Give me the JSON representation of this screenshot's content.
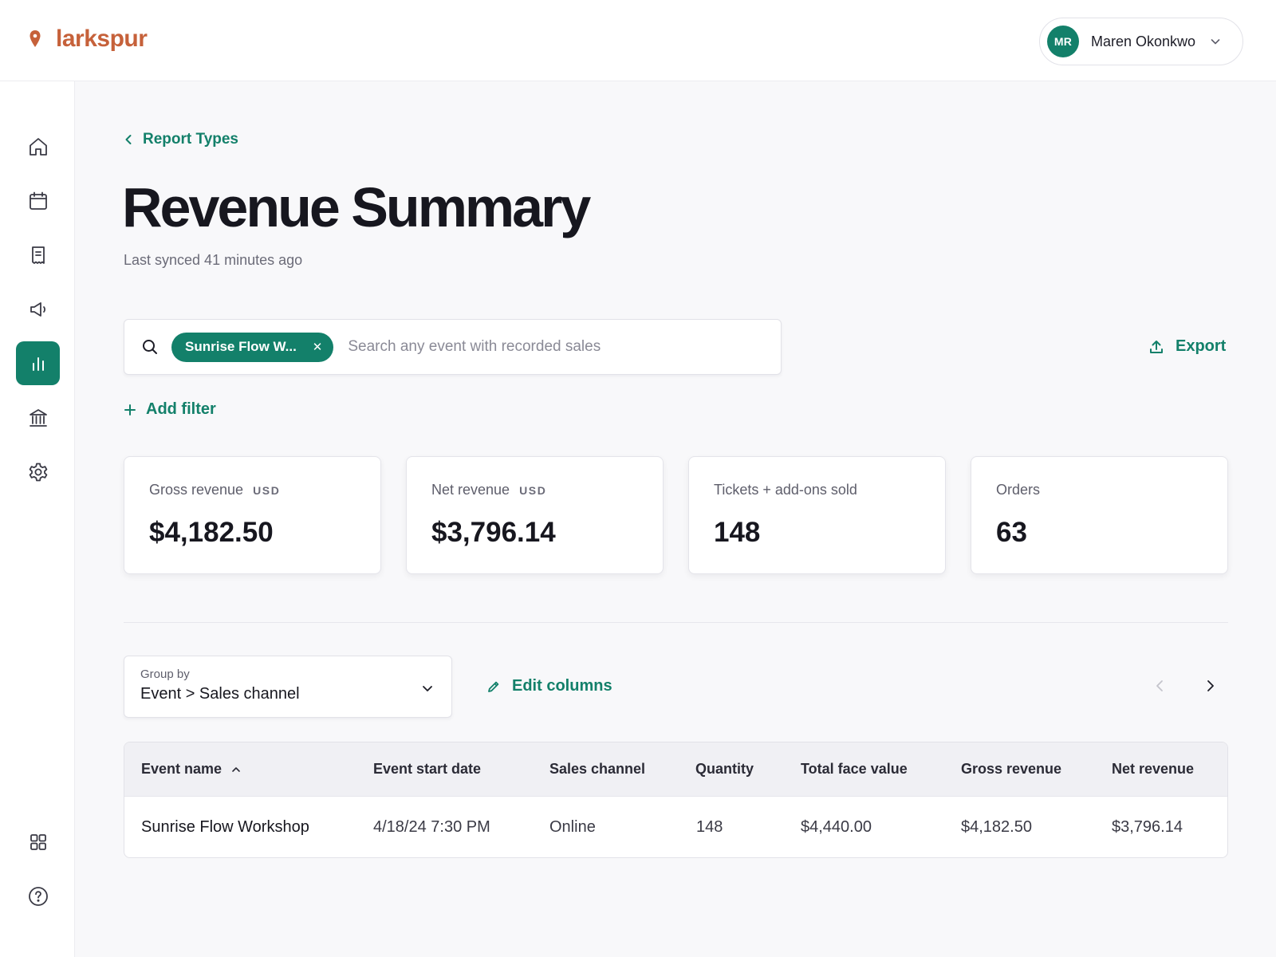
{
  "app": {
    "brand": "larkspur",
    "brand_color": "#c6613a",
    "accent_color": "#13806a"
  },
  "user": {
    "initials": "MR",
    "name": "Maren Okonkwo"
  },
  "sidebar": {
    "items": [
      {
        "icon": "home-icon",
        "active": false
      },
      {
        "icon": "calendar-icon",
        "active": false
      },
      {
        "icon": "receipt-icon",
        "active": false
      },
      {
        "icon": "megaphone-icon",
        "active": false
      },
      {
        "icon": "bar-chart-icon",
        "active": true
      },
      {
        "icon": "bank-icon",
        "active": false
      },
      {
        "icon": "gear-icon",
        "active": false
      }
    ],
    "bottom_items": [
      {
        "icon": "apps-grid-icon"
      },
      {
        "icon": "help-icon"
      }
    ]
  },
  "breadcrumb": {
    "label": "Report Types"
  },
  "page": {
    "title": "Revenue Summary",
    "sync_status": "Last synced 41 minutes ago"
  },
  "search": {
    "chip_label": "Sunrise Flow W...",
    "placeholder": "Search any event with recorded sales",
    "value": ""
  },
  "actions": {
    "export_label": "Export",
    "add_filter_label": "Add filter",
    "edit_columns_label": "Edit columns"
  },
  "stats": [
    {
      "label": "Gross revenue",
      "unit": "USD",
      "value": "$4,182.50"
    },
    {
      "label": "Net revenue",
      "unit": "USD",
      "value": "$3,796.14"
    },
    {
      "label": "Tickets + add-ons sold",
      "unit": "",
      "value": "148"
    },
    {
      "label": "Orders",
      "unit": "",
      "value": "63"
    }
  ],
  "group_by": {
    "label": "Group by",
    "value": "Event > Sales channel"
  },
  "table": {
    "columns": [
      "Event name",
      "Event start date",
      "Sales channel",
      "Quantity",
      "Total face value",
      "Gross revenue",
      "Net revenue"
    ],
    "sorted_column": "Event name",
    "sort_direction": "ascending",
    "rows": [
      [
        "Sunrise Flow Workshop",
        "4/18/24 7:30 PM",
        "Online",
        "148",
        "$4,440.00",
        "$4,182.50",
        "$3,796.14"
      ]
    ]
  }
}
